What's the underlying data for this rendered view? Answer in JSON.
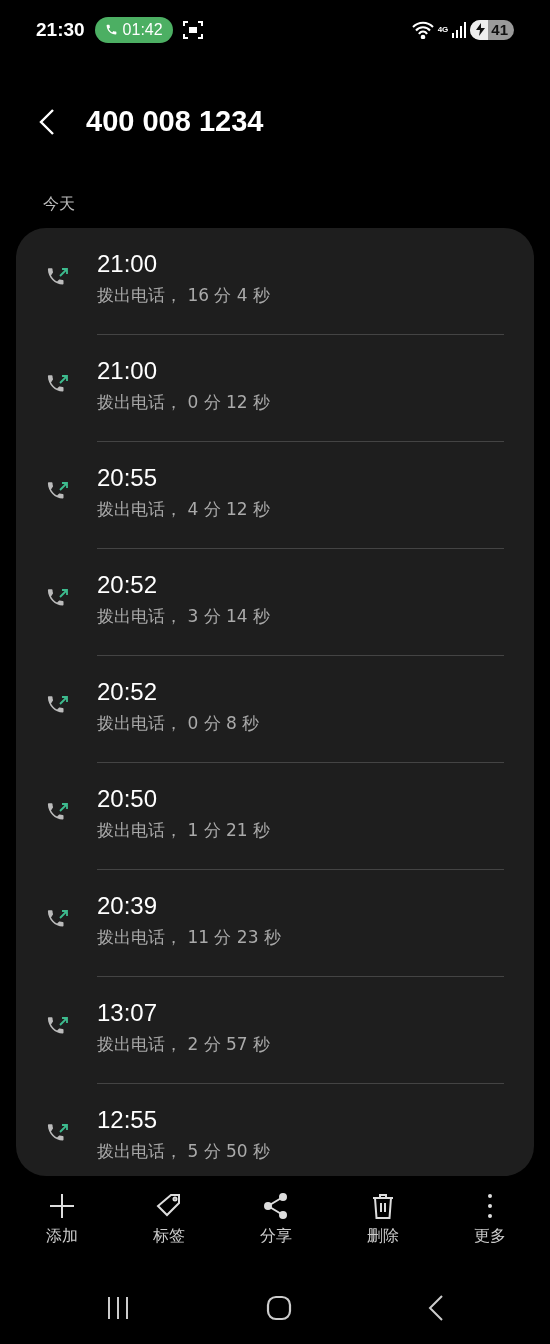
{
  "status_bar": {
    "time": "21:30",
    "call_timer": "01:42",
    "network": "4G",
    "battery": "41"
  },
  "header": {
    "title": "400 008 1234"
  },
  "section": {
    "label": "今天"
  },
  "calls": [
    {
      "time": "21:00",
      "detail": "拨出电话， 16 分 4 秒"
    },
    {
      "time": "21:00",
      "detail": "拨出电话， 0 分 12 秒"
    },
    {
      "time": "20:55",
      "detail": "拨出电话， 4 分 12 秒"
    },
    {
      "time": "20:52",
      "detail": "拨出电话， 3 分 14 秒"
    },
    {
      "time": "20:52",
      "detail": "拨出电话， 0 分 8 秒"
    },
    {
      "time": "20:50",
      "detail": "拨出电话， 1 分 21 秒"
    },
    {
      "time": "20:39",
      "detail": "拨出电话， 11 分 23 秒"
    },
    {
      "time": "13:07",
      "detail": "拨出电话， 2 分 57 秒"
    },
    {
      "time": "12:55",
      "detail": "拨出电话， 5 分 50 秒"
    }
  ],
  "actions": [
    {
      "kind": "add",
      "label": "添加"
    },
    {
      "kind": "tag",
      "label": "标签"
    },
    {
      "kind": "share",
      "label": "分享"
    },
    {
      "kind": "delete",
      "label": "删除"
    },
    {
      "kind": "more",
      "label": "更多"
    }
  ]
}
